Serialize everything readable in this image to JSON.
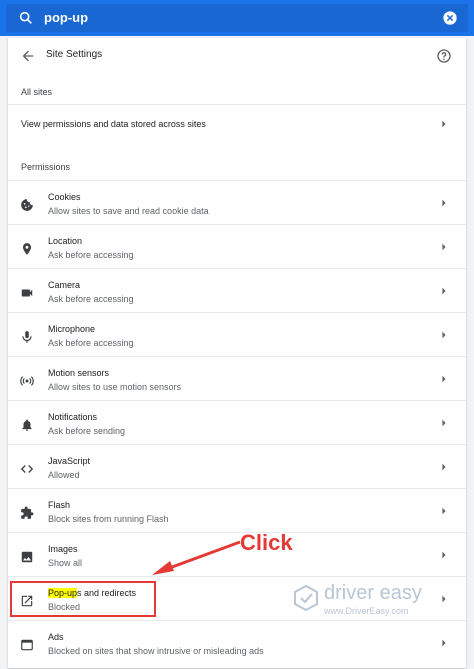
{
  "search": {
    "value": "pop-up",
    "icon": "search-icon",
    "clear_icon": "close-icon"
  },
  "header": {
    "title": "Site Settings",
    "back_icon": "arrow-back-icon",
    "help_icon": "help-icon"
  },
  "all_sites": {
    "label": "All sites",
    "link": "View permissions and data stored across sites"
  },
  "permissions": {
    "label": "Permissions",
    "items": [
      {
        "title": "Cookies",
        "sub": "Allow sites to save and read cookie data",
        "icon": "cookie-icon"
      },
      {
        "title": "Location",
        "sub": "Ask before accessing",
        "icon": "location-pin-icon"
      },
      {
        "title": "Camera",
        "sub": "Ask before accessing",
        "icon": "camera-icon"
      },
      {
        "title": "Microphone",
        "sub": "Ask before accessing",
        "icon": "microphone-icon"
      },
      {
        "title": "Motion sensors",
        "sub": "Allow sites to use motion sensors",
        "icon": "sensors-icon"
      },
      {
        "title": "Notifications",
        "sub": "Ask before sending",
        "icon": "bell-icon"
      },
      {
        "title": "JavaScript",
        "sub": "Allowed",
        "icon": "code-icon"
      },
      {
        "title": "Flash",
        "sub": "Block sites from running Flash",
        "icon": "puzzle-icon"
      },
      {
        "title": "Images",
        "sub": "Show all",
        "icon": "image-icon"
      },
      {
        "title_highlight": "Pop-up",
        "title_rest": "s and redirects",
        "sub": "Blocked",
        "icon": "open-in-new-icon"
      },
      {
        "title": "Ads",
        "sub": "Blocked on sites that show intrusive or misleading ads",
        "icon": "ads-icon"
      }
    ]
  },
  "annotation": {
    "click_label": "Click",
    "color": "#e53935"
  },
  "watermark": {
    "name": "driver easy",
    "url": "www.DriverEasy.com"
  },
  "colors": {
    "topbar": "#1a73e8",
    "highlight": "#ffff00"
  }
}
